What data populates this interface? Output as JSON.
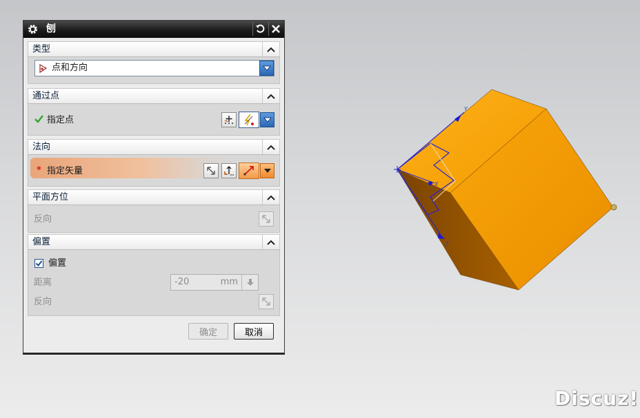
{
  "dialog": {
    "title": "刨",
    "icons": {
      "settings": "gear-icon",
      "reset": "reset-icon",
      "close": "close-icon"
    }
  },
  "sections": {
    "type": {
      "header": "类型",
      "value": "点和方向",
      "value_icon": "point-direction-icon"
    },
    "through_point": {
      "header": "通过点",
      "row_label": "指定点",
      "status": "complete",
      "status_icon": "checkmark-icon",
      "status_color": "#2fa32f"
    },
    "normal": {
      "header": "法向",
      "row_label": "指定矢量",
      "status": "required",
      "status_mark": "*",
      "status_color": "#d11a1a",
      "highlight_color": "#e9a57a"
    },
    "plane_orientation": {
      "header": "平面方位",
      "reverse_label": "反向"
    },
    "offset": {
      "header": "偏置",
      "checkbox_label": "偏置",
      "checked": true,
      "distance_label": "距离",
      "distance_value": "-20",
      "distance_unit": "mm",
      "reverse_label": "反向"
    }
  },
  "buttons": {
    "ok": "确定",
    "cancel": "取消"
  },
  "viewport": {
    "part_color": "#f7a100",
    "part_shade_color": "#995900",
    "sketch_color": "#2424d6",
    "axis_labels": {
      "top": "Y",
      "middle": "X",
      "bottom": "Z"
    }
  },
  "watermark": "Discuz!"
}
